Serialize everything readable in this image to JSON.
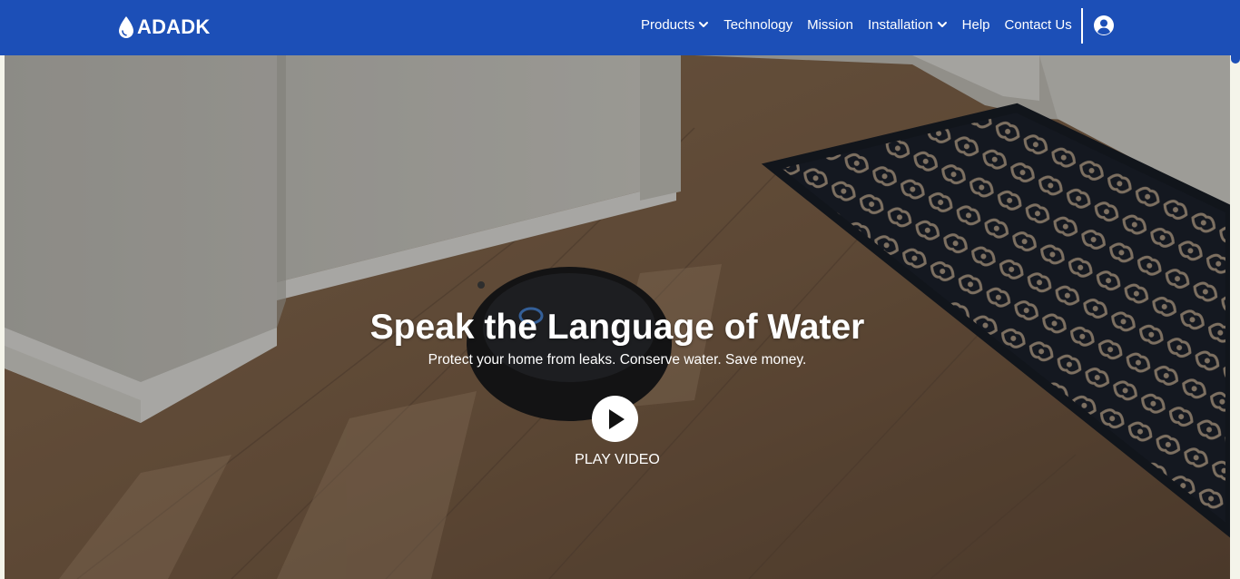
{
  "brand": {
    "name": "ADADK",
    "icon": "water-drop-icon"
  },
  "nav": {
    "items": [
      {
        "label": "Products",
        "has_dropdown": true
      },
      {
        "label": "Technology",
        "has_dropdown": false
      },
      {
        "label": "Mission",
        "has_dropdown": false
      },
      {
        "label": "Installation",
        "has_dropdown": true
      },
      {
        "label": "Help",
        "has_dropdown": false
      },
      {
        "label": "Contact Us",
        "has_dropdown": false
      }
    ],
    "account_icon": "user-circle-icon"
  },
  "hero": {
    "title": "Speak the Language of Water",
    "subtitle": "Protect your home from leaks. Conserve water. Save money.",
    "play_label": "PLAY VIDEO",
    "play_icon": "play-icon"
  },
  "colors": {
    "nav_bg": "#1c4fb7",
    "text": "#ffffff",
    "page_edge": "#f4f4ea"
  }
}
